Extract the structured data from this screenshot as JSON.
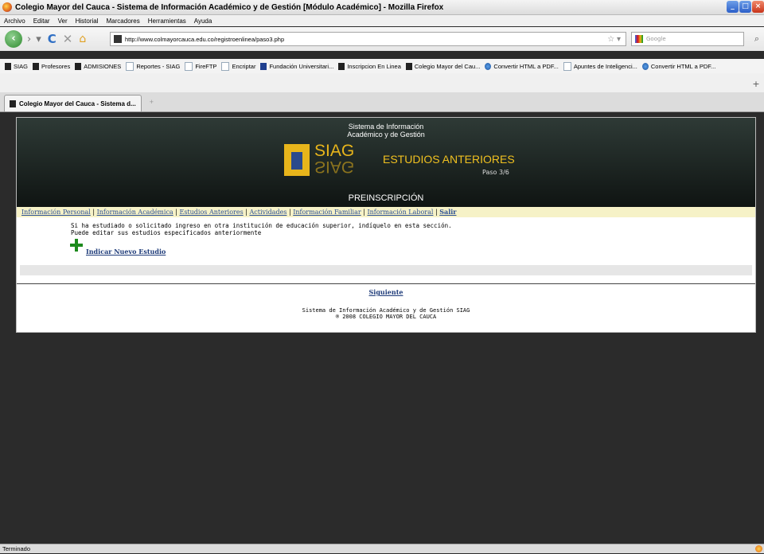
{
  "window": {
    "title": "Colegio Mayor del Cauca - Sistema de Información Académico y de Gestión [Módulo Académico] - Mozilla Firefox"
  },
  "menu": [
    "Archivo",
    "Editar",
    "Ver",
    "Historial",
    "Marcadores",
    "Herramientas",
    "Ayuda"
  ],
  "address": {
    "url": "http://www.colmayorcauca.edu.co/registroenlinea/paso3.php"
  },
  "search": {
    "placeholder": "Google"
  },
  "bookmarks": [
    {
      "label": "SIAG",
      "icon": "siag"
    },
    {
      "label": "Profesores",
      "icon": "siag"
    },
    {
      "label": "ADMISIONES",
      "icon": "siag"
    },
    {
      "label": "Reportes - SIAG",
      "icon": "page"
    },
    {
      "label": "FireFTP",
      "icon": "page"
    },
    {
      "label": "Encriptar",
      "icon": "page"
    },
    {
      "label": "Fundación Universitari...",
      "icon": "grid"
    },
    {
      "label": "Inscripcion En Linea",
      "icon": "siag"
    },
    {
      "label": "Colegio Mayor del Cau...",
      "icon": "siag"
    },
    {
      "label": "Convertir HTML a PDF...",
      "icon": "globe"
    },
    {
      "label": "Apuntes de Inteligenci...",
      "icon": "page"
    },
    {
      "label": "Convertir HTML a PDF...",
      "icon": "globe"
    }
  ],
  "tab": {
    "label": "Colegio Mayor del Cauca - Sistema d..."
  },
  "header": {
    "sistema_line1": "Sistema de Información",
    "sistema_line2": "Académico y de Gestión",
    "logo_text": "SIAG",
    "section": "ESTUDIOS ANTERIORES",
    "step": "Paso 3/6",
    "preinscripcion": "PREINSCRIPCIÓN"
  },
  "nav": {
    "items": [
      "Información Personal",
      "Información Académica",
      "Estudios Anteriores",
      "Actividades",
      "Información Familiar",
      "Información Laboral"
    ],
    "logout": "Salir"
  },
  "content": {
    "line1": "Si ha estudiado o solicitado ingreso en otra institución de educación superior, indíquelo en esta sección.",
    "line2": "Puede editar sus estudios especificados anteriormente",
    "add_link": "Indicar Nuevo Estudio",
    "next": "Siguiente"
  },
  "footer": {
    "line1": "Sistema de Información Académico y de Gestión SIAG",
    "line2": "® 2008 COLEGIO MAYOR DEL CAUCA"
  },
  "status": {
    "text": "Terminado"
  },
  "colors": {
    "header_bg": "#1c2623",
    "accent": "#f0c020",
    "nav_bg": "#f6f2c7",
    "link": "#2b4f95"
  }
}
